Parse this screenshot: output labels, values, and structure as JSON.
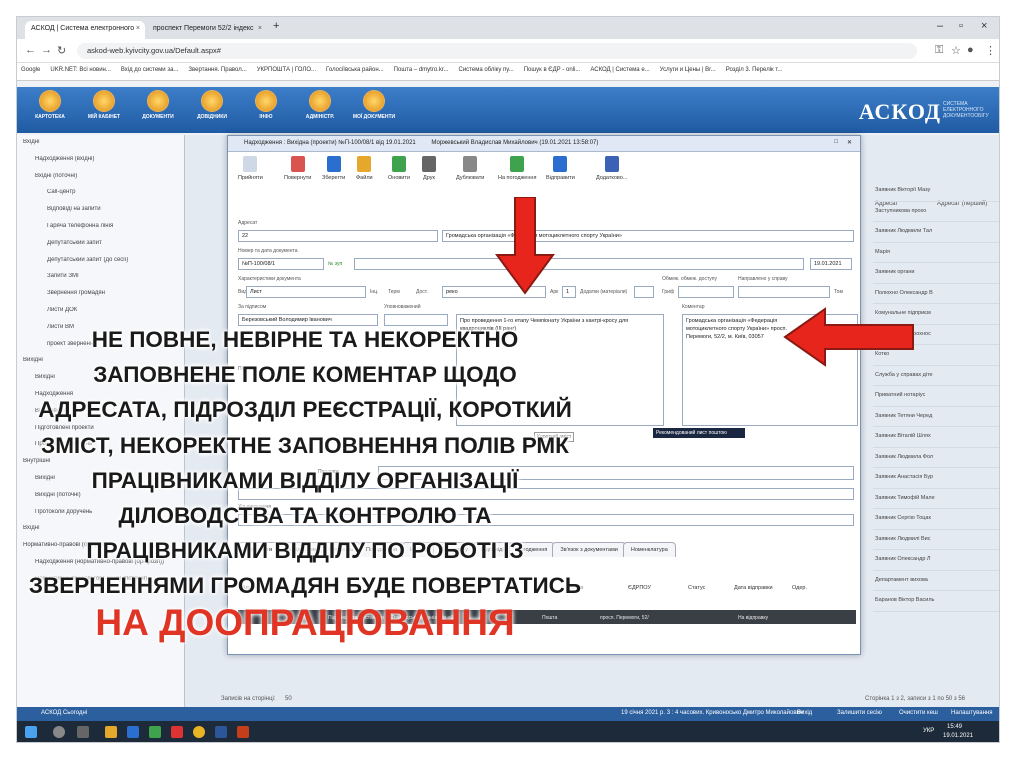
{
  "browser": {
    "tabs": [
      {
        "label": "АСКОД | Система електронного"
      },
      {
        "label": "проспект Перемоги 52/2 індекс"
      }
    ],
    "url": "askod-web.kyivcity.gov.ua/Default.aspx#",
    "bookmarks": [
      "Google",
      "UKR.NET: Всі новин...",
      "Вхід до системи за...",
      "Звертання. Правол...",
      "УКРПОШТА | ГОЛО...",
      "Голосіївська район...",
      "Пошта – dmytro.kr...",
      "Система обліку пу...",
      "Пошук в ЄДР - onli...",
      "АСКОД | Система е...",
      "Услуги и Цены | Br...",
      "Розділ 3. Перелік т..."
    ]
  },
  "app": {
    "brand": "АСКОД",
    "brand_sub": "СИСТЕМА ЕЛЕКТРОННОГО ДОКУМЕНТООБІГУ",
    "modules": [
      "КАРТОТЕКА",
      "МІЙ КАБІНЕТ",
      "ДОКУМЕНТИ",
      "ДОВІДНИКИ",
      "ІНФО",
      "АДМІНІСТР.",
      "МОЇ ДОКУМЕНТИ"
    ]
  },
  "sidebar": {
    "items": [
      "Вхідні",
      "Надходження (вхідні)",
      "Вхідні (поточні)",
      "Call-центр",
      "Відповіді на запити",
      "Гаряча телефонна лінія",
      "Депутатський запит",
      "Депутатський запит (до сесії)",
      "Запити ЗМІ",
      "Звернення громадян",
      "Листи ДОК",
      "Листи ВМ",
      "проект звернення",
      "Вихідні",
      "Вихідні",
      "Надходження",
      "Відправлені",
      "Підготовлені проекти",
      "Протоколи доручень",
      "Внутрішні",
      "Вихідні",
      "Вихідні (поточні)",
      "Протоколи доручень",
      "Вхідні",
      "Нормативно-правові (орг-розп)",
      "Надходження (нормативно-правові (орг-розп))",
      "Нормативно-правові (орг-розп) (поточні)"
    ]
  },
  "background_list": {
    "header_right": [
      "Адресат",
      "Адресат (перший)"
    ],
    "rows": [
      "Заявник Вікторії Мазу",
      "Заступникова прохо",
      "Заявник Людмили Тал",
      "Марія",
      "Заявник органи",
      "Полюхно Олександр В",
      "Комунальне підприєм",
      "Департамент прохнос",
      "Котко",
      "Служба у справах діте",
      "Приватний нотаріус",
      "Заявник Тетяни Черед",
      "Заявник Віталій Шлях",
      "Заявник Людмила Фол",
      "Заявник Анастасія Бур",
      "Заявник Тимофій Мале",
      "Заявник Сергію Тоцак",
      "Заявник Людмилі Вис",
      "Заявник Олександр Л",
      "Департамент вихова",
      "Баранов Віктор Василь"
    ],
    "pagination": "Сторінка 1 з 2, записи з 1 по 50 з 56",
    "page_size_label": "Записів на сторінці:",
    "page_size": "50"
  },
  "dialog": {
    "title": "Надходження : Вихідна (проекти) №П-100/08/1 від 19.01.2021",
    "author": "Моржевський Владислав Михайлович (19.01.2021 13:58:07)",
    "toolbar": [
      "Прийняти",
      "Повернути",
      "Зберегти",
      "Файли",
      "Оновити",
      "Друк",
      "Дублювати",
      "На погодження",
      "Відправити",
      "Додатково..."
    ],
    "fields": {
      "adresat_label": "Адресат",
      "adresat_code": "22",
      "adresat_value": "Громадська організація «Федерація мотоциклетного спорту України»",
      "regnum_label": "Номер та дата документа",
      "regnum": "№П-100/08/1",
      "regnum_suffix": "№ зуп",
      "reg_date": "19.01.2021",
      "kind_label": "Характеристики документа",
      "vid_label": "Вид",
      "vid": "Лист",
      "inc_label": "Інц.",
      "term_label": "Терм",
      "dost_label": "Дост.",
      "dost_value": "реко",
      "ark_label": "Арк",
      "ark_value": "1",
      "dodatky_label": "Додатки (матеріали)",
      "access_label": "Обмеж. обмеж. доступу",
      "sprava_label": "Направлено у справу",
      "grif_label": "Гриф",
      "tom_label": "Том",
      "signer_label": "За підписом",
      "signer": "Березовський Володимир Іванович",
      "executor_label": "Уповноважений",
      "summary": "Про проведення 1-го етапу Чемпіонату України з кантрі-кросу для квадроциклів (III ранг)",
      "summary_label": "Короткий зміст",
      "comment_label": "Коментар",
      "comment": "Громадська організація «Федерація мотоциклетного спорту України» просп. Перемоги, 52/2, м. Київ, 03057",
      "dropdown_option": "Рекомендований лист поштою",
      "podpys_label": "Підпис",
      "prodovzh_label": "Продовж.",
      "khid_label": "Хід виконання"
    },
    "subtabs": [
      "Адресати",
      "За підписом",
      "Контроль",
      "Погодження",
      "На візу",
      "До номеру",
      "Відповіді",
      "Погодження",
      "Зв'язок з документами",
      "Номенклатура"
    ],
    "grid": {
      "headers": [
        "Адресати",
        "Бланк",
        "ЄДРПОУ",
        "Статус",
        "Дата відправки",
        "Одер."
      ],
      "row": [
        "22",
        "Підприємства, установи та Громадська організація «Ф",
        "Пошта",
        "просп. Перемоги, 52/",
        "На відправку"
      ]
    }
  },
  "windows_bar": {
    "left": "АСКОД Сьогодні",
    "status": "19 січня 2021 р. 3 : 4 часових. Кривоносько Дмитро Миколайович",
    "buttons": [
      "Вихід",
      "Залишити сесію",
      "Очистити кеш",
      "Налаштування"
    ]
  },
  "taskbar": {
    "lang": "УКР",
    "time": "15:49",
    "date": "19.01.2021"
  },
  "annotation": {
    "lines": [
      "НЕ ПОВНЕ, НЕВІРНЕ ТА НЕКОРЕКТНО",
      "ЗАПОВНЕНЕ ПОЛЕ КОМЕНТАР ЩОДО",
      "АДРЕСАТА, ПІДРОЗДІЛ РЕЄСТРАЦІЇ, КОРОТКИЙ",
      "ЗМІСТ, НЕКОРЕКТНЕ ЗАПОВНЕННЯ ПОЛІВ РМК",
      "ПРАЦІВНИКАМИ ВІДДІЛУ ОРГАНІЗАЦІЇ",
      "ДІЛОВОДСТВА ТА КОНТРОЛЮ ТА",
      "ПРАЦІВНИКАМИ ВІДДІЛУ ПО РОБОТІ ІЗ",
      "ЗВЕРНЕННЯМИ ГРОМАДЯН БУДЕ ПОВЕРТАТИСЬ"
    ],
    "emphasis": "НА ДООПРАЦЮВАННЯ",
    "colors": {
      "text": "#1a1a1a",
      "emphasis": "#e03424",
      "arrow": "#e8251c"
    }
  }
}
